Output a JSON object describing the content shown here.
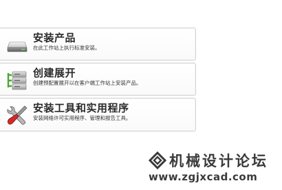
{
  "items": [
    {
      "title": "安装产品",
      "description": "在此工作站上执行标准安装。",
      "icon": "drive-icon"
    },
    {
      "title": "创建展开",
      "description": "创建预配置展开以在客户端工作站上安装产品。",
      "icon": "deploy-icon"
    },
    {
      "title": "安装工具和实用程序",
      "description": "安装网络许可实用程序、管理和报告工具。",
      "icon": "tools-icon"
    }
  ],
  "watermark": {
    "name": "机械设计论坛",
    "url": "www.zgjxcad.com"
  },
  "colors": {
    "panel_border": "#d4d4d4",
    "title_text": "#2a2a2a",
    "deploy_green": "#4aa832",
    "tools_red": "#d02a2a"
  }
}
